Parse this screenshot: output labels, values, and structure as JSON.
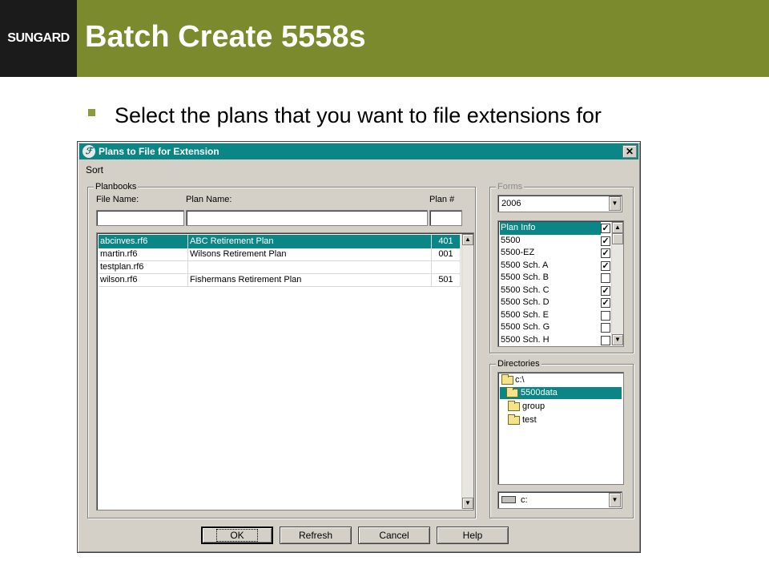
{
  "slide": {
    "logo": "SUNGARD",
    "title": "Batch Create 5558s",
    "bullet": "Select the plans that you want to file extensions for"
  },
  "dialog": {
    "title": "Plans to File for Extension",
    "menu": [
      "Sort"
    ],
    "planbooks": {
      "group_label": "Planbooks",
      "columns": [
        "File Name:",
        "Plan Name:",
        "Plan #"
      ],
      "filters": [
        "",
        "",
        ""
      ],
      "rows": [
        {
          "file": "abcinves.rf6",
          "plan": "ABC Retirement Plan",
          "num": "401",
          "selected": true
        },
        {
          "file": "martin.rf6",
          "plan": "Wilsons Retirement Plan",
          "num": "001",
          "selected": false
        },
        {
          "file": "testplan.rf6",
          "plan": "",
          "num": "",
          "selected": false
        },
        {
          "file": "wilson.rf6",
          "plan": "Fishermans Retirement Plan",
          "num": "501",
          "selected": false
        }
      ]
    },
    "forms": {
      "group_label": "Forms",
      "year": "2006",
      "items": [
        {
          "name": "Plan Info",
          "checked": true,
          "selected": true
        },
        {
          "name": "5500",
          "checked": true
        },
        {
          "name": "5500-EZ",
          "checked": true
        },
        {
          "name": "5500 Sch. A",
          "checked": true
        },
        {
          "name": "5500 Sch. B",
          "checked": false
        },
        {
          "name": "5500 Sch. C",
          "checked": true
        },
        {
          "name": "5500 Sch. D",
          "checked": true
        },
        {
          "name": "5500 Sch. E",
          "checked": false
        },
        {
          "name": "5500 Sch. G",
          "checked": false
        },
        {
          "name": "5500 Sch. H",
          "checked": false
        }
      ]
    },
    "directories": {
      "group_label": "Directories",
      "items": [
        {
          "name": "c:\\",
          "level": 0,
          "selected": false
        },
        {
          "name": "5500data",
          "level": 1,
          "selected": true
        },
        {
          "name": "group",
          "level": 1,
          "selected": false
        },
        {
          "name": "test",
          "level": 1,
          "selected": false
        }
      ],
      "drive": "c:"
    },
    "buttons": {
      "ok": "OK",
      "refresh": "Refresh",
      "cancel": "Cancel",
      "help": "Help"
    }
  },
  "colors": {
    "header": "#7b8a2c",
    "logo_bg": "#1b1b1b",
    "titlebar": "#0b8686",
    "bullet": "#8c9a3c",
    "dialog_face": "#d4d0c8"
  }
}
